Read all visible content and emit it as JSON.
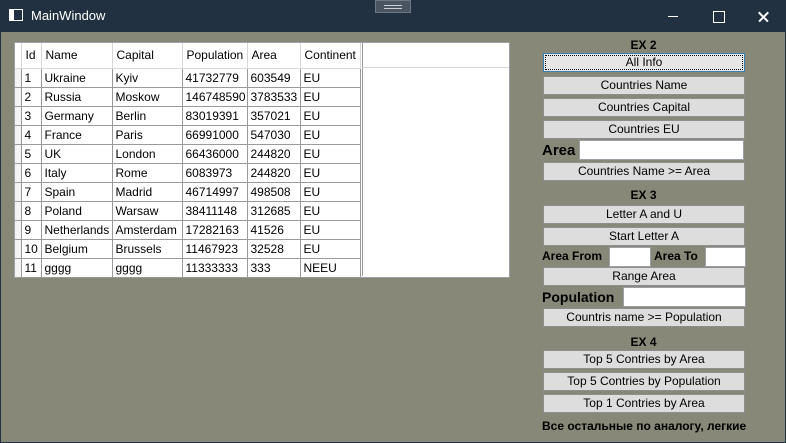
{
  "window": {
    "title": "MainWindow"
  },
  "table": {
    "columns": [
      "Id",
      "Name",
      "Capital",
      "Population",
      "Area",
      "Continent"
    ],
    "rows": [
      [
        "1",
        "Ukraine",
        "Kyiv",
        "41732779",
        "603549",
        "EU"
      ],
      [
        "2",
        "Russia",
        "Moskow",
        "146748590",
        "3783533",
        "EU"
      ],
      [
        "3",
        "Germany",
        "Berlin",
        "83019391",
        "357021",
        "EU"
      ],
      [
        "4",
        "France",
        "Paris",
        "66991000",
        "547030",
        "EU"
      ],
      [
        "5",
        "UK",
        "London",
        "66436000",
        "244820",
        "EU"
      ],
      [
        "6",
        "Italy",
        "Rome",
        "6083973",
        "244820",
        "EU"
      ],
      [
        "7",
        "Spain",
        "Madrid",
        "46714997",
        "498508",
        "EU"
      ],
      [
        "8",
        "Poland",
        "Warsaw",
        "38411148",
        "312685",
        "EU"
      ],
      [
        "9",
        "Netherlands",
        "Amsterdam",
        "17282163",
        "41526",
        "EU"
      ],
      [
        "10",
        "Belgium",
        "Brussels",
        "11467923",
        "32528",
        "EU"
      ],
      [
        "11",
        "gggg",
        "gggg",
        "11333333",
        "333",
        "NEEU"
      ]
    ]
  },
  "panel": {
    "ex2_title": "EX 2",
    "all_info": "All Info",
    "countries_name": "Countries Name",
    "countries_capital": "Countries Capital",
    "countries_eu": "Countries EU",
    "area_label": "Area",
    "area_value": "",
    "countries_name_area": "Countries Name >= Area",
    "ex3_title": "EX 3",
    "letter_a_u": "Letter A and U",
    "start_letter_a": "Start Letter A",
    "area_from_label": "Area From",
    "area_from_value": "",
    "area_to_label": "Area To",
    "area_to_value": "",
    "range_area": "Range Area",
    "population_label": "Population",
    "population_value": "",
    "countries_population": "Countris name >= Population",
    "ex4_title": "EX 4",
    "top5_area": "Top 5 Contries by Area",
    "top5_population": "Top 5 Contries by Population",
    "top1_area": "Top 1 Contries by Area",
    "note": "Все остальные по аналогу, легкие"
  },
  "colors": {
    "titlebar": "#223141",
    "client_background": "#878878",
    "button_face": "#dddddd"
  }
}
